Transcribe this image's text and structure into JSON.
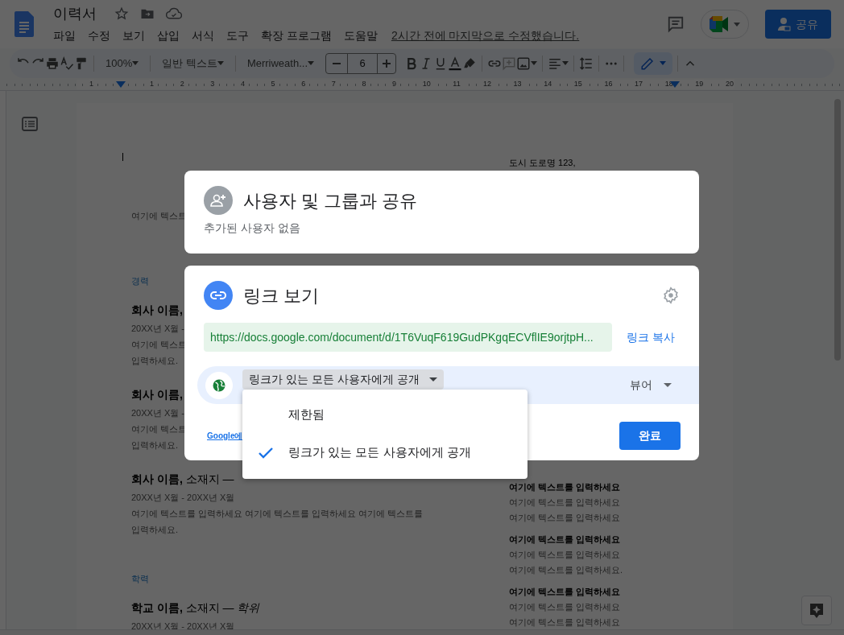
{
  "app": {
    "title": "이력서",
    "menus": [
      "파일",
      "수정",
      "보기",
      "삽입",
      "서식",
      "도구",
      "확장 프로그램",
      "도움말"
    ],
    "last_edit": "2시간 전에 마지막으로 수정했습니다.",
    "share_button": "공유"
  },
  "toolbar": {
    "zoom": "100%",
    "style": "일반 텍스트",
    "font": "Merriweath...",
    "font_size": "6"
  },
  "ruler": [
    "1",
    "1",
    "2",
    "3",
    "4",
    "5",
    "6",
    "7",
    "8",
    "9",
    "10",
    "11",
    "12",
    "13",
    "14",
    "15",
    "16",
    "17",
    "18",
    "19",
    "20"
  ],
  "document": {
    "left": [
      {
        "kind": "subtitle",
        "text": "여기에 텍스트"
      },
      {
        "kind": "heading",
        "text": "경력"
      },
      {
        "kind": "job",
        "text": "**회사 이름,**"
      },
      {
        "kind": "date",
        "text": "20XX년 X월 -"
      },
      {
        "kind": "body",
        "text": "여기에 텍스트"
      },
      {
        "kind": "body",
        "text": "입력하세요."
      },
      {
        "kind": "job",
        "text": "**회사 이름,**"
      },
      {
        "kind": "date",
        "text": "20XX년 X월 -"
      },
      {
        "kind": "body",
        "text": "여기에 텍스트"
      },
      {
        "kind": "body",
        "text": "입력하세요."
      },
      {
        "kind": "job",
        "text": "**회사 이름,** 소재지 —"
      },
      {
        "kind": "date",
        "text": "20XX년 X월 - 20XX년 X월"
      },
      {
        "kind": "body",
        "text": "여기에 텍스트를 입력하세요 여기에 텍스트를 입력하세요 여기에 텍스트를"
      },
      {
        "kind": "body",
        "text": "입력하세요."
      },
      {
        "kind": "heading",
        "text": "학력"
      },
      {
        "kind": "job",
        "text": "**학교 이름,** 소재지 — *학위*"
      },
      {
        "kind": "date",
        "text": "20XX년 X월 - 20XX년 X월"
      }
    ],
    "address": "도시 도로명 123,",
    "right_groups": [
      {
        "heading": "여기에 텍스트를 입력하세요",
        "lines": [
          "여기에 텍스트를 입력하세요",
          "여기에 텍스트를 입력하세요"
        ]
      },
      {
        "heading": "여기에 텍스트를 입력하세요",
        "lines": [
          "여기에 텍스트를 입력하세요",
          "여기에 텍스트를 입력하세요."
        ]
      },
      {
        "heading": "여기에 텍스트를 입력하세요",
        "lines": [
          "여기에 텍스트를 입력하세요",
          "여기에 텍스트를 입력하세요"
        ]
      }
    ]
  },
  "share_dialog": {
    "people": {
      "title": "사용자 및 그룹과 공유",
      "empty": "추가된 사용자 없음"
    },
    "link": {
      "title": "링크 보기",
      "url": "https://docs.google.com/document/d/1T6VuqF619GudPKgqECVflIE9orjtpH...",
      "copy": "링크 복사",
      "access": "링크가 있는 모든 사용자에게 공개",
      "role": "뷰어",
      "feedback": "Google에",
      "done": "완료"
    },
    "access_menu": [
      {
        "label": "제한됨",
        "selected": false
      },
      {
        "label": "링크가 있는 모든 사용자에게 공개",
        "selected": true
      }
    ]
  }
}
